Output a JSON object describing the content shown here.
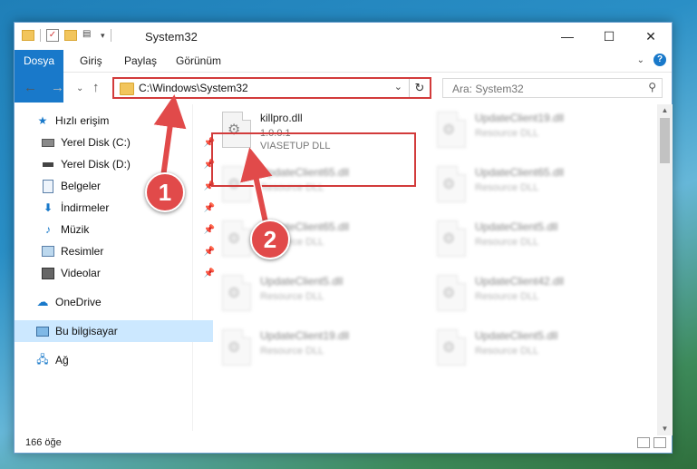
{
  "window": {
    "title": "System32",
    "controls": {
      "minimize": "—",
      "maximize": "☐",
      "close": "✕"
    }
  },
  "ribbon": {
    "tabs": [
      "Dosya",
      "Giriş",
      "Paylaş",
      "Görünüm"
    ]
  },
  "address": {
    "path": "C:\\Windows\\System32",
    "search_placeholder": "Ara: System32"
  },
  "nav": {
    "items": [
      {
        "label": "Hızlı erişim",
        "icon": "star-icon",
        "pinned": false
      },
      {
        "label": "Yerel Disk (C:)",
        "icon": "drive-icon",
        "pinned": true
      },
      {
        "label": "Yerel Disk (D:)",
        "icon": "drive-icon",
        "pinned": true
      },
      {
        "label": "Belgeler",
        "icon": "document-icon",
        "pinned": true
      },
      {
        "label": "İndirmeler",
        "icon": "download-icon",
        "pinned": true
      },
      {
        "label": "Müzik",
        "icon": "music-icon",
        "pinned": true
      },
      {
        "label": "Resimler",
        "icon": "picture-icon",
        "pinned": true
      },
      {
        "label": "Videolar",
        "icon": "video-icon",
        "pinned": true
      },
      {
        "label": "OneDrive",
        "icon": "cloud-icon",
        "pinned": false
      },
      {
        "label": "Bu bilgisayar",
        "icon": "computer-icon",
        "pinned": false,
        "selected": true
      },
      {
        "label": "Ağ",
        "icon": "network-icon",
        "pinned": false
      }
    ]
  },
  "files": [
    {
      "name": "killpro.dll",
      "line1": "1.0.0.1",
      "line2": "VIASETUP DLL",
      "blurred": false
    },
    {
      "name": "UpdateClient19.dll",
      "line1": "Resource DLL",
      "blurred": true
    },
    {
      "name": "UpdateClient65.dll",
      "line1": "Resource DLL",
      "blurred": true
    },
    {
      "name": "UpdateClient65.dll",
      "line1": "Resource DLL",
      "blurred": true
    },
    {
      "name": "UpdateClient65.dll",
      "line1": "Resource DLL",
      "blurred": true
    },
    {
      "name": "UpdateClient5.dll",
      "line1": "Resource DLL",
      "blurred": true
    },
    {
      "name": "UpdateClient5.dll",
      "line1": "Resource DLL",
      "blurred": true
    },
    {
      "name": "UpdateClient42.dll",
      "line1": "Resource DLL",
      "blurred": true
    },
    {
      "name": "UpdateClient19.dll",
      "line1": "Resource DLL",
      "blurred": true
    },
    {
      "name": "UpdateClient5.dll",
      "line1": "Resource DLL",
      "blurred": true
    }
  ],
  "status": {
    "count": "166 öğe"
  },
  "annotations": {
    "step1": "1",
    "step2": "2"
  },
  "colors": {
    "accent": "#1979ca",
    "highlight": "#d23b3b",
    "selection": "#cce8ff"
  }
}
